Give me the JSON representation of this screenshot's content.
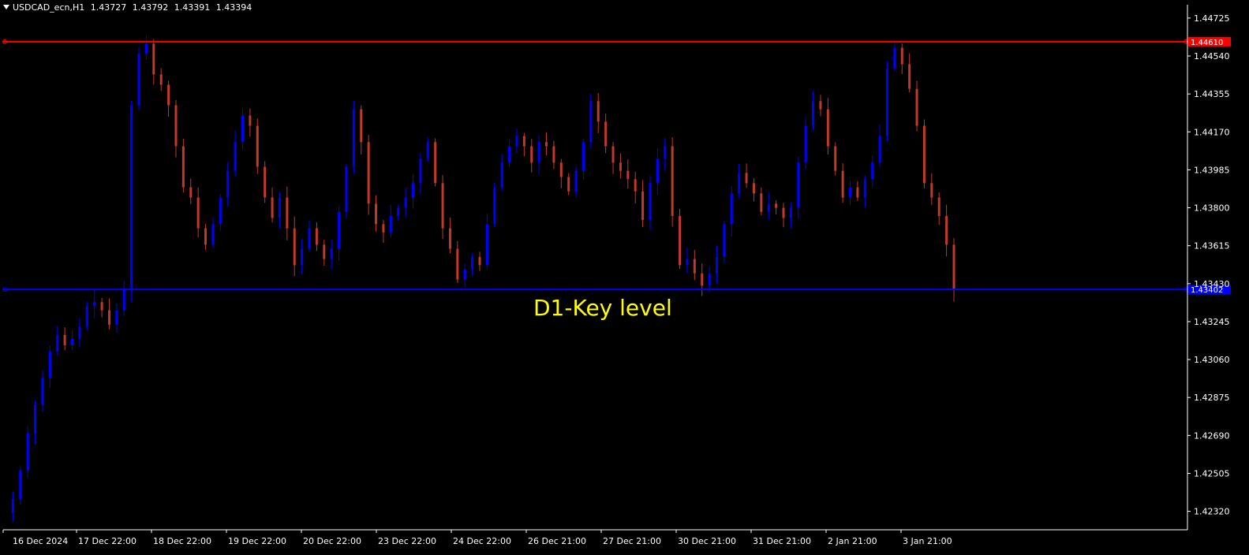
{
  "header": {
    "symbol": "USDCAD_ecn,H1",
    "open": "1.43727",
    "high": "1.43792",
    "low": "1.43391",
    "close": "1.43394"
  },
  "colors": {
    "background": "#000000",
    "axis": "#ffffff",
    "bull": "#0000ff",
    "bear": "#c0392b",
    "resistance": "#ff0000",
    "support": "#0000ff",
    "annotation": "#ffff00"
  },
  "chart_data": {
    "type": "candlestick",
    "symbol": "USDCAD_ecn",
    "timeframe": "H1",
    "ylim": [
      1.4223,
      1.4479
    ],
    "y_ticks": [
      "1.44725",
      "1.44540",
      "1.44355",
      "1.44170",
      "1.43985",
      "1.43800",
      "1.43615",
      "1.43430",
      "1.43245",
      "1.43060",
      "1.42875",
      "1.42690",
      "1.42505",
      "1.42320"
    ],
    "x_ticks": [
      "16 Dec 2024",
      "17 Dec 22:00",
      "18 Dec 22:00",
      "19 Dec 22:00",
      "20 Dec 22:00",
      "23 Dec 22:00",
      "24 Dec 22:00",
      "26 Dec 21:00",
      "27 Dec 21:00",
      "30 Dec 21:00",
      "31 Dec 21:00",
      "2 Jan 21:00",
      "3 Jan 21:00"
    ],
    "levels": [
      {
        "price": 1.4461,
        "label": "1.44610",
        "color": "#ff0000"
      },
      {
        "price": 1.43402,
        "label": "1.43402",
        "color": "#0000ff"
      }
    ],
    "annotation": "D1-Key level",
    "close_path": [
      1.4231,
      1.4238,
      1.4252,
      1.427,
      1.4284,
      1.4297,
      1.431,
      1.4318,
      1.4313,
      1.4316,
      1.4322,
      1.4332,
      1.4334,
      1.433,
      1.4323,
      1.433,
      1.434,
      1.443,
      1.4455,
      1.446,
      1.4445,
      1.444,
      1.443,
      1.441,
      1.439,
      1.4385,
      1.437,
      1.4362,
      1.4372,
      1.4385,
      1.4398,
      1.4412,
      1.4425,
      1.442,
      1.44,
      1.4385,
      1.4375,
      1.4385,
      1.437,
      1.4352,
      1.436,
      1.437,
      1.4362,
      1.4355,
      1.436,
      1.4378,
      1.44,
      1.4428,
      1.4412,
      1.4382,
      1.4372,
      1.4368,
      1.4376,
      1.438,
      1.4385,
      1.4392,
      1.4404,
      1.4412,
      1.4392,
      1.437,
      1.436,
      1.4345,
      1.435,
      1.4356,
      1.4352,
      1.4372,
      1.439,
      1.4402,
      1.441,
      1.4415,
      1.441,
      1.4402,
      1.4412,
      1.441,
      1.4402,
      1.4395,
      1.4388,
      1.4398,
      1.4412,
      1.4432,
      1.4422,
      1.441,
      1.4402,
      1.4398,
      1.4394,
      1.4388,
      1.4374,
      1.4392,
      1.4404,
      1.441,
      1.4376,
      1.4352,
      1.4355,
      1.4348,
      1.4342,
      1.4348,
      1.4356,
      1.4372,
      1.4387,
      1.4397,
      1.4392,
      1.4387,
      1.4378,
      1.4382,
      1.438,
      1.4375,
      1.438,
      1.4402,
      1.442,
      1.4432,
      1.4428,
      1.441,
      1.4398,
      1.4385,
      1.439,
      1.4385,
      1.4394,
      1.4402,
      1.4415,
      1.4448,
      1.4458,
      1.445,
      1.4438,
      1.442,
      1.4392,
      1.4385,
      1.4376,
      1.4362,
      1.434
    ]
  }
}
